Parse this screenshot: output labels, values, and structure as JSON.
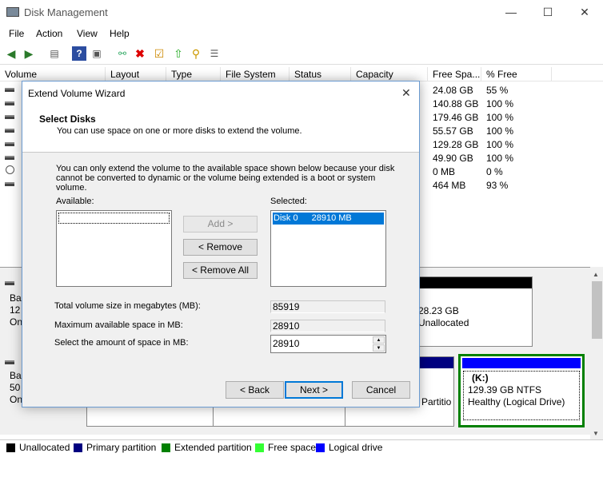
{
  "window": {
    "title": "Disk Management",
    "minimize": "—",
    "maximize": "☐",
    "close": "✕"
  },
  "menu": [
    "File",
    "Action",
    "View",
    "Help"
  ],
  "columns": [
    "Volume",
    "Layout",
    "Type",
    "File System",
    "Status",
    "Capacity",
    "Free Spa...",
    "% Free"
  ],
  "rows": [
    {
      "free": "24.08 GB",
      "pct": "55 %"
    },
    {
      "free": "140.88 GB",
      "pct": "100 %"
    },
    {
      "free": "179.46 GB",
      "pct": "100 %"
    },
    {
      "free": "55.57 GB",
      "pct": "100 %"
    },
    {
      "free": "129.28 GB",
      "pct": "100 %"
    },
    {
      "free": "49.90 GB",
      "pct": "100 %"
    },
    {
      "free": "0 MB",
      "pct": "0 %"
    },
    {
      "free": "464 MB",
      "pct": "93 %"
    }
  ],
  "lower": {
    "disk1": {
      "l1": "Ba",
      "l2": "12",
      "l3": "On",
      "seg_size": "28.23 GB",
      "seg_status": "Unallocated"
    },
    "disk2": {
      "l1": "Ba",
      "l2": "50",
      "l3": "On",
      "partial": "Partitio"
    },
    "k_drive": {
      "letter": "(K:)",
      "size": "129.39 GB NTFS",
      "status": "Healthy (Logical Drive)"
    }
  },
  "legend": [
    {
      "label": "Unallocated",
      "color": "#000000"
    },
    {
      "label": "Primary partition",
      "color": "#000080"
    },
    {
      "label": "Extended partition",
      "color": "#008000"
    },
    {
      "label": "Free space",
      "color": "#33ff33"
    },
    {
      "label": "Logical drive",
      "color": "#0000ff"
    }
  ],
  "dialog": {
    "title": "Extend Volume Wizard",
    "heading": "Select Disks",
    "subheading": "You can use space on one or more disks to extend the volume.",
    "info": "You can only extend the volume to the available space shown below because your disk cannot be converted to dynamic or the volume being extended is a boot or system volume.",
    "available_label": "Available:",
    "selected_label": "Selected:",
    "selected_item": {
      "disk": "Disk 0",
      "size": "28910 MB"
    },
    "add_button": "Add >",
    "remove_button": "< Remove",
    "remove_all_button": "< Remove All",
    "total_label": "Total volume size in megabytes (MB):",
    "total_value": "85919",
    "max_label": "Maximum available space in MB:",
    "max_value": "28910",
    "amount_label": "Select the amount of space in MB:",
    "amount_value": "28910",
    "back_button": "< Back",
    "next_button": "Next >",
    "cancel_button": "Cancel"
  }
}
